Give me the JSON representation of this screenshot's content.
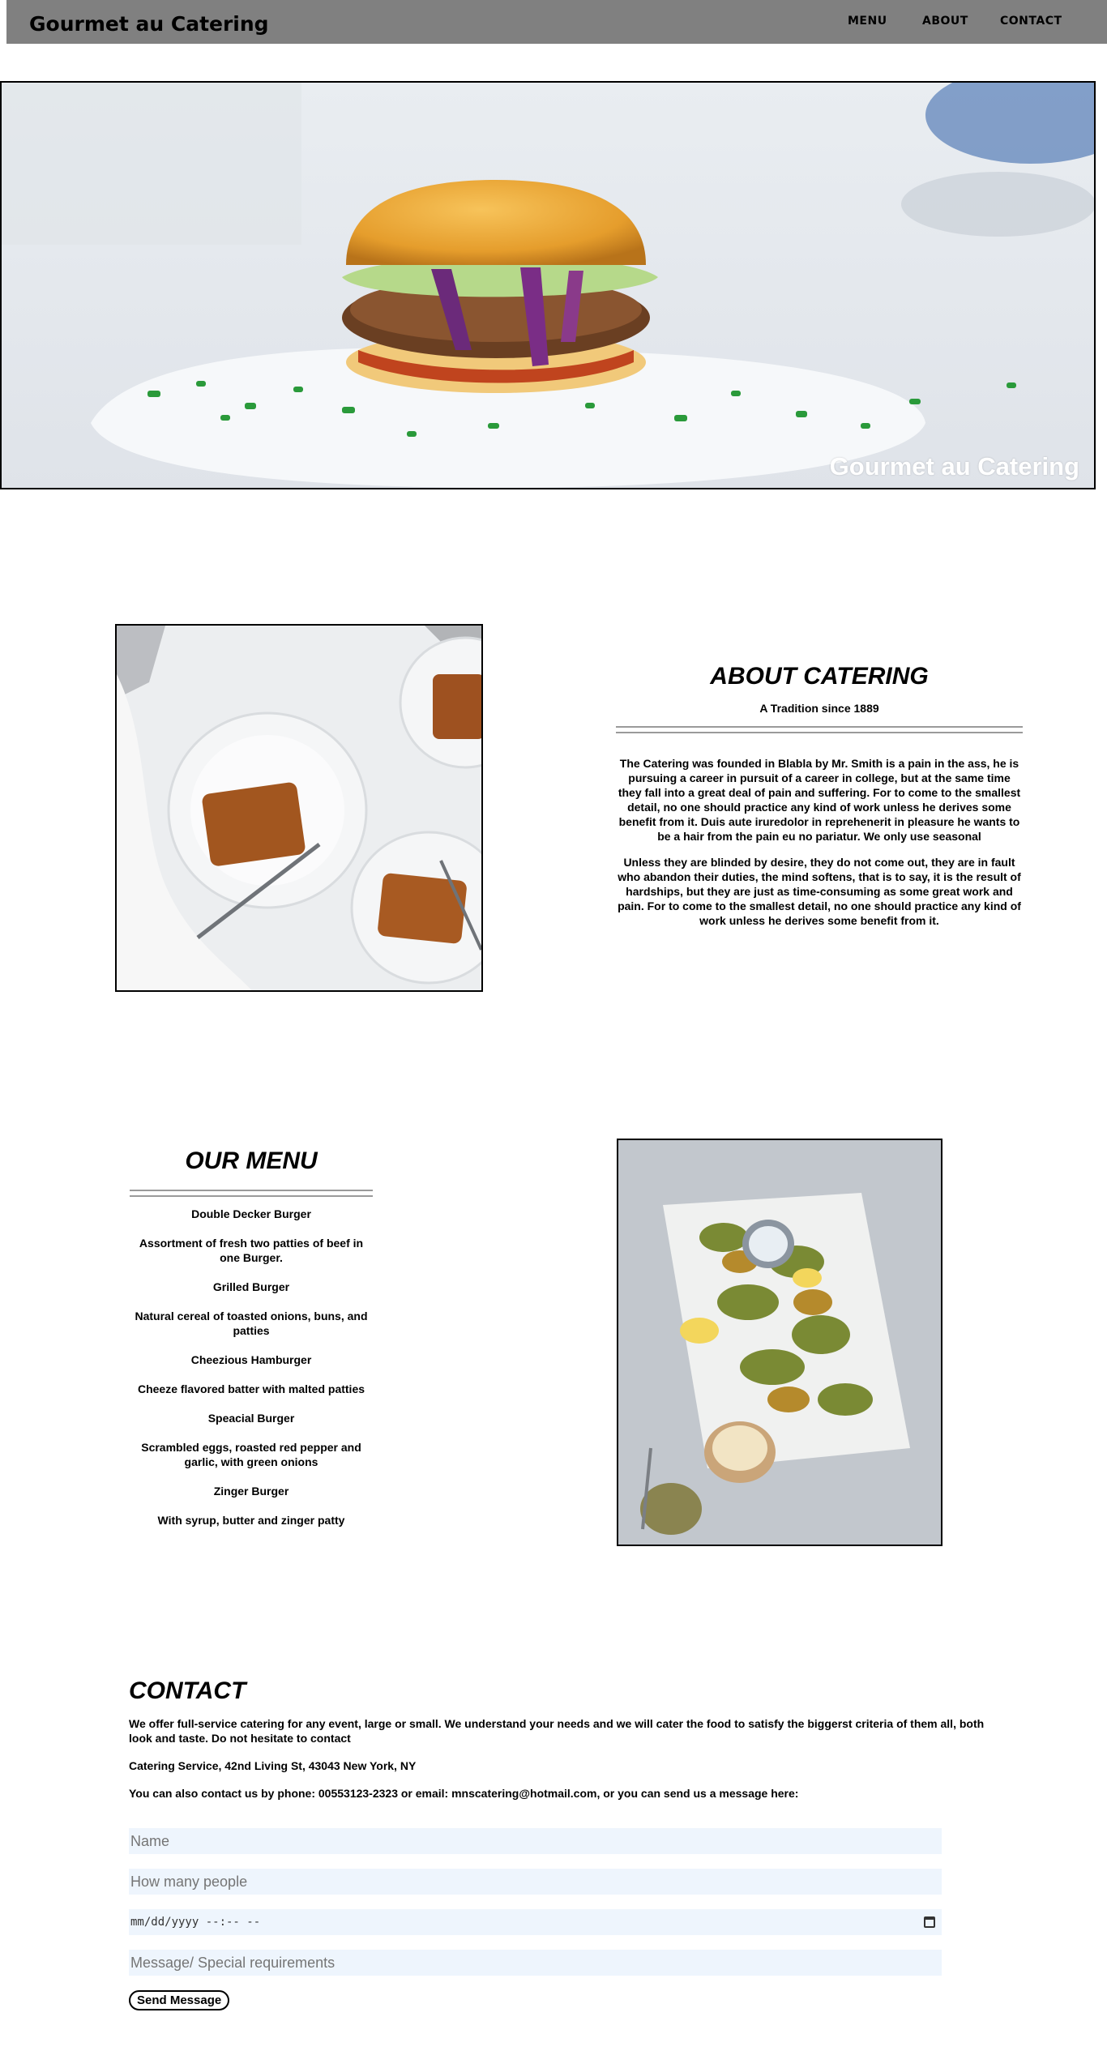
{
  "nav": {
    "brand": "Gourmet au Catering",
    "links": [
      "MENU",
      "ABOUT",
      "CONTACT"
    ]
  },
  "hero": {
    "caption": "Gourmet au Catering"
  },
  "about": {
    "title": "ABOUT CATERING",
    "tagline": "A Tradition since 1889",
    "paragraphs": [
      "The Catering was founded in Blabla by Mr. Smith is a pain in the ass, he is pursuing a career in pursuit of a career in college, but at the same time they fall into a great deal of pain and suffering. For to come to the smallest detail, no one should practice any kind of work unless he derives some benefit from it. Duis aute iruredolor in reprehenerit in pleasure he wants to be a hair from the pain eu no pariatur. We only use seasonal",
      "Unless they are blinded by desire, they do not come out, they are in fault who abandon their duties, the mind softens, that is to say, it is the result of hardships, but they are just as time-consuming as some great work and pain. For to come to the smallest detail, no one should practice any kind of work unless he derives some benefit from it."
    ]
  },
  "menu": {
    "title": "OUR MENU",
    "items": [
      {
        "name": "Double Decker Burger",
        "desc": "Assortment of fresh two patties of beef in one Burger."
      },
      {
        "name": "Grilled Burger",
        "desc": "Natural cereal of toasted onions, buns, and patties"
      },
      {
        "name": "Cheezious Hamburger",
        "desc": "Cheeze flavored batter with malted patties"
      },
      {
        "name": "Speacial Burger",
        "desc": "Scrambled eggs, roasted red pepper and garlic, with green onions"
      },
      {
        "name": "Zinger Burger",
        "desc": "With syrup, butter and zinger patty"
      }
    ]
  },
  "contact": {
    "title": "CONTACT",
    "intro": "We offer full-service catering for any event, large or small. We understand your needs and we will cater the food to satisfy the biggerst criteria of them all, both look and taste. Do not hesitate to contact",
    "address": "Catering Service, 42nd Living St, 43043 New York, NY",
    "phone_line": "You can also contact us by phone: 00553123-2323 or email: mnscatering@hotmail.com, or you can send us a message here:",
    "form": {
      "name_placeholder": "Name",
      "people_placeholder": "How many people",
      "date_placeholder": "mm/dd/yyyy --:-- --",
      "message_placeholder": "Message/ Special requirements",
      "send_label": "Send Message"
    }
  },
  "colors": {
    "navbar": "#808080",
    "field_bg": "#eef5fd"
  },
  "icons": [
    "calendar-icon"
  ]
}
